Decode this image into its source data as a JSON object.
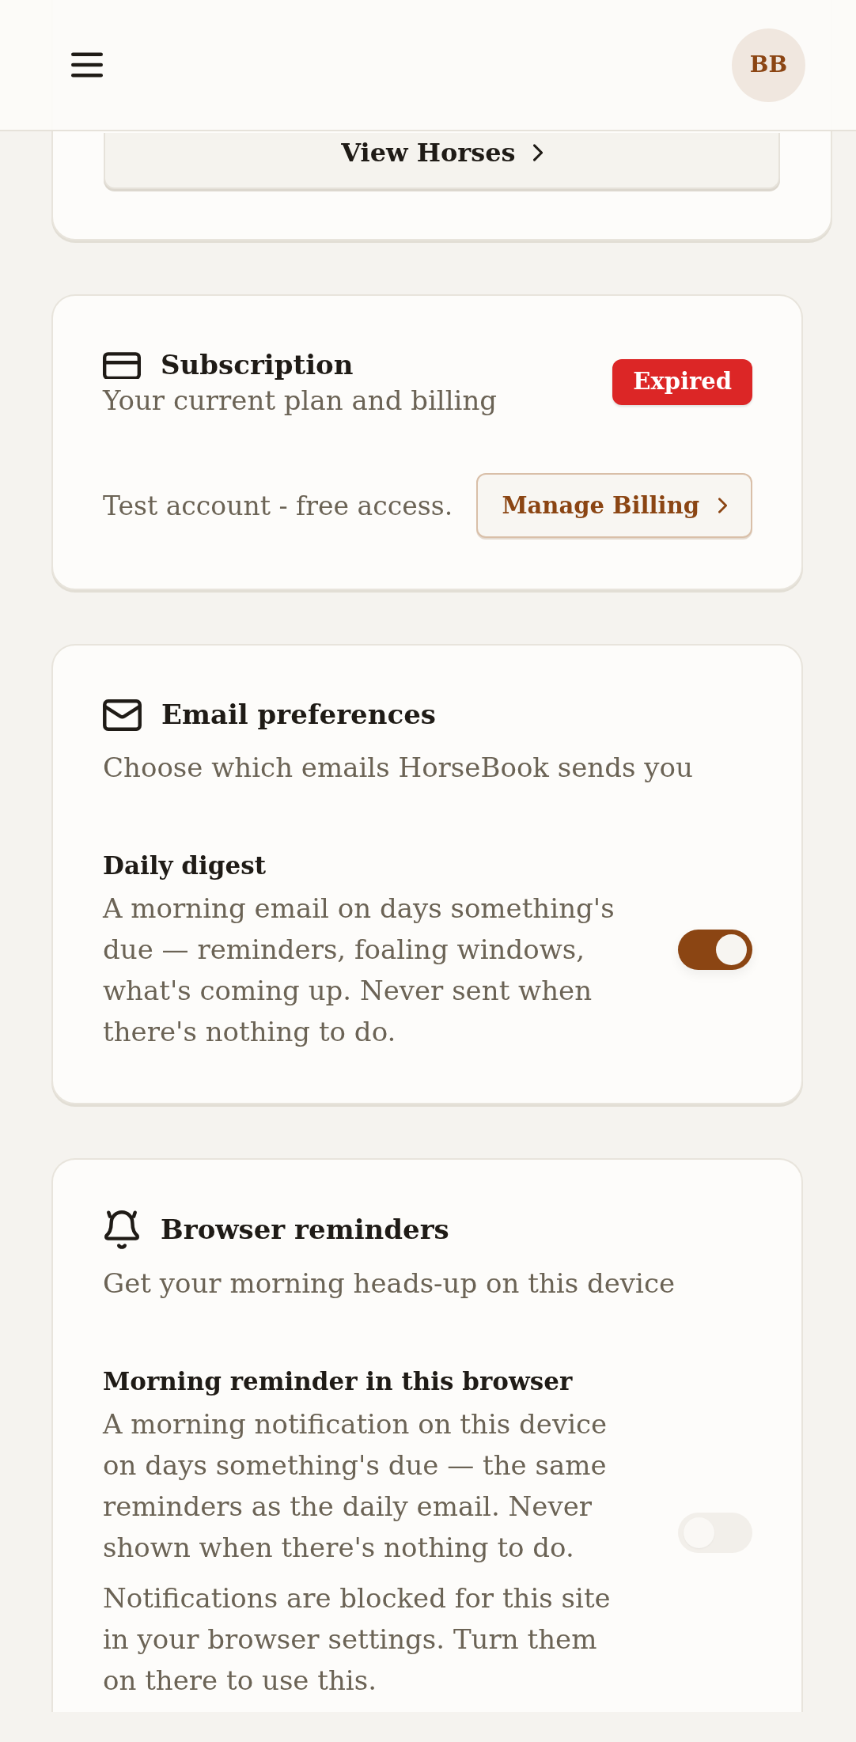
{
  "header": {
    "avatar_initials": "BB"
  },
  "horses_card": {
    "button": "View Horses"
  },
  "subscription_card": {
    "title": "Subscription",
    "subtitle": "Your current plan and billing",
    "status_badge": "Expired",
    "note": "Test account - free access.",
    "button": "Manage Billing"
  },
  "email_card": {
    "title": "Email preferences",
    "subtitle": "Choose which emails HorseBook sends you",
    "setting": {
      "label": "Daily digest",
      "description": "A morning email on days something's due — reminders, foaling windows, what's coming up. Never sent when there's nothing to do.",
      "on": true
    }
  },
  "browser_card": {
    "title": "Browser reminders",
    "subtitle": "Get your morning heads-up on this device",
    "setting": {
      "label": "Morning reminder in this browser",
      "description": "A morning notification on this device on days something's due — the same reminders as the daily email. Never shown when there's nothing to do.",
      "note": "Notifications are blocked for this site in your browser settings. Turn them on there to use this.",
      "on": false,
      "disabled": true
    }
  }
}
